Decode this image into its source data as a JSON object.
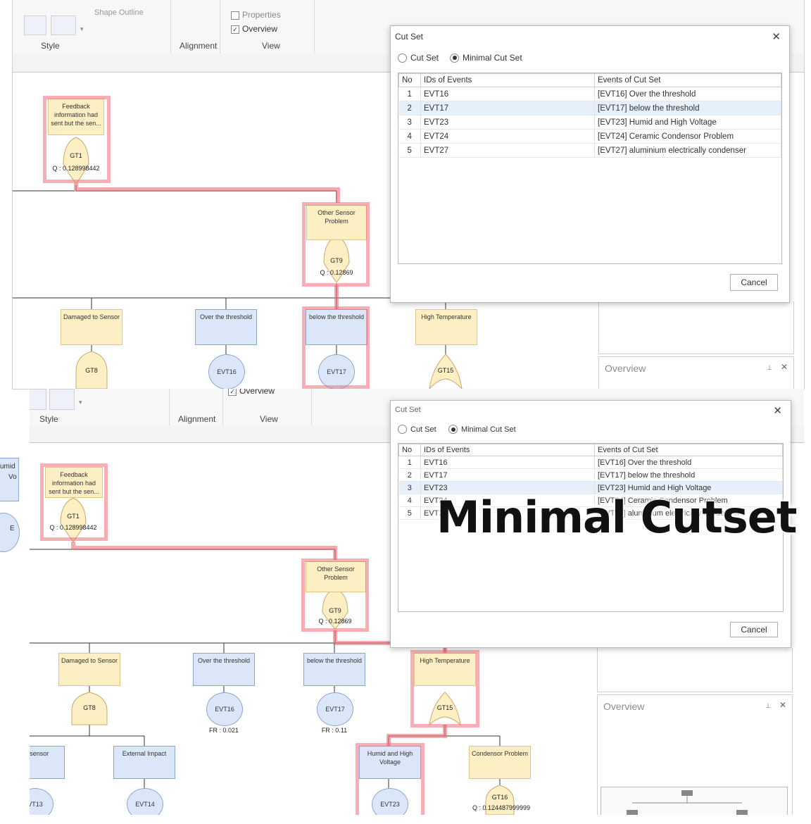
{
  "top": {
    "ribbon": {
      "groups": [
        "Style",
        "Alignment",
        "View"
      ],
      "view_checks": [
        "Properties",
        "Overview"
      ],
      "shape_outline_label": "Shape Outline"
    },
    "nodes": {
      "feedback": "Feedback information had sent but the sen...",
      "gt1": "GT1",
      "gt1_q": "Q : 0.128998442",
      "other_sensor": "Other Sensor Problem",
      "gt9": "GT9",
      "gt9_q": "Q : 0.12869",
      "damaged": "Damaged to Sensor",
      "over": "Over the threshold",
      "below": "below the threshold",
      "high_temp": "High Temperature",
      "gt8": "GT8",
      "evt16": "EVT16",
      "evt17": "EVT17",
      "gt15": "GT15"
    },
    "overview_title": "Overview",
    "dialog": {
      "title": "Cut Set",
      "radio_cut_set": "Cut Set",
      "radio_minimal": "Minimal Cut Set",
      "selected_radio": "Minimal Cut Set",
      "columns": [
        "No",
        "IDs of Events",
        "Events of Cut Set"
      ],
      "rows": [
        {
          "no": "1",
          "id": "EVT16",
          "event": "[EVT16] Over the threshold"
        },
        {
          "no": "2",
          "id": "EVT17",
          "event": "[EVT17] below the threshold"
        },
        {
          "no": "3",
          "id": "EVT23",
          "event": "[EVT23] Humid and High Voltage"
        },
        {
          "no": "4",
          "id": "EVT24",
          "event": "[EVT24] Ceramic Condensor Problem"
        },
        {
          "no": "5",
          "id": "EVT27",
          "event": "[EVT27] aluminium electrically condenser"
        }
      ],
      "selected_row": 2,
      "cancel": "Cancel"
    }
  },
  "bottom": {
    "ribbon": {
      "groups": [
        "Style",
        "Alignment",
        "View"
      ],
      "view_checks": [
        "Overview"
      ]
    },
    "left_edge_text": [
      "umid",
      "Vo",
      "E"
    ],
    "nodes": {
      "feedback": "Feedback information had sent but the sen...",
      "gt1": "GT1",
      "gt1_q": "Q : 0.128998442",
      "other_sensor": "Other Sensor Problem",
      "gt9": "GT9",
      "gt9_q": "Q : 0.12869",
      "damaged": "Damaged to Sensor",
      "over": "Over the threshold",
      "below": "below the threshold",
      "high_temp": "High Temperature",
      "gt8": "GT8",
      "evt16": "EVT16",
      "evt16_fr": "FR : 0.021",
      "evt17": "EVT17",
      "evt17_fr": "FR : 0.11",
      "gt15": "GT15",
      "ned_sensor": "ned sensor",
      "external": "External Impact",
      "humid": "Humid and High Voltage",
      "condensor": "Condensor Problem",
      "evt13": "VT13",
      "evt14": "EVT14",
      "evt23": "EVT23",
      "gt16": "GT16",
      "gt16_q": "Q : 0.124487999999"
    },
    "overview_title": "Overview",
    "dialog": {
      "title": "Cut Set",
      "radio_cut_set": "Cut Set",
      "radio_minimal": "Minimal Cut Set",
      "selected_radio": "Minimal Cut Set",
      "columns": [
        "No",
        "IDs of Events",
        "Events of Cut Set"
      ],
      "rows": [
        {
          "no": "1",
          "id": "EVT16",
          "event": "[EVT16] Over the threshold"
        },
        {
          "no": "2",
          "id": "EVT17",
          "event": "[EVT17] below the threshold"
        },
        {
          "no": "3",
          "id": "EVT23",
          "event": "[EVT23] Humid and High Voltage"
        },
        {
          "no": "4",
          "id": "EVT24",
          "event": "[EVT24] Ceramic Condensor Problem"
        },
        {
          "no": "5",
          "id": "EVT27",
          "event": "[EVT27] aluminium electrically condenser"
        }
      ],
      "selected_row": 3,
      "cancel": "Cancel"
    }
  },
  "caption": "Minimal Cutset",
  "colors": {
    "highlight": "#f06e78",
    "event_yellow": "#fdefc4",
    "event_blue": "#dbe7f8"
  }
}
